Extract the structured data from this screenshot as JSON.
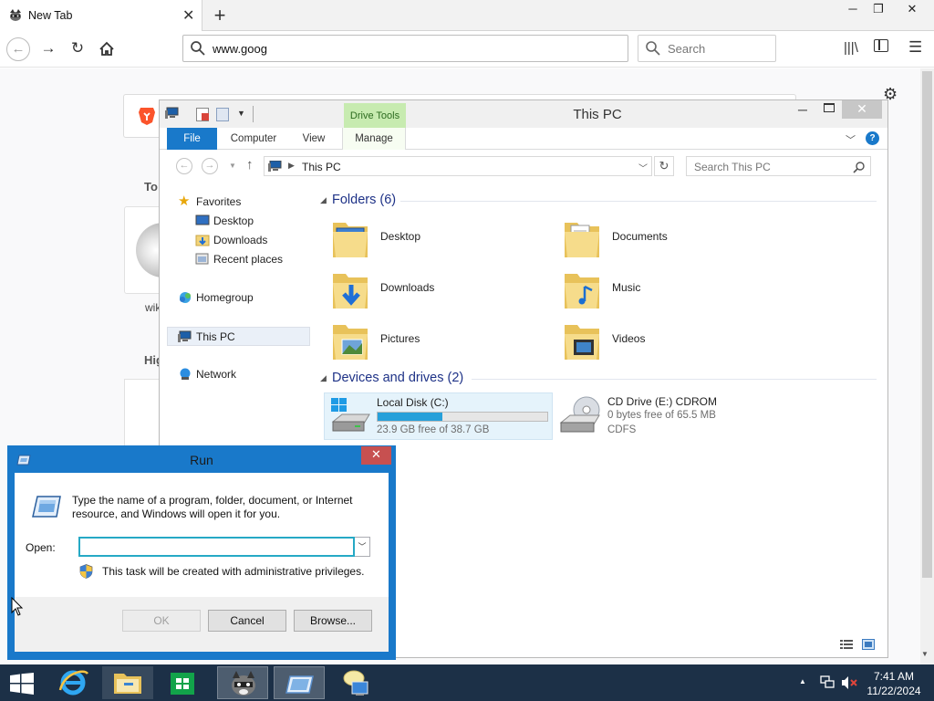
{
  "browser": {
    "tab_title": "New Tab",
    "tab_close": "✕",
    "new_tab": "+",
    "url_value": "www.goog",
    "search_placeholder": "Search",
    "win_min": "─",
    "win_max": "❐",
    "win_close": "✕"
  },
  "newtab_page": {
    "top_sites_heading": "To",
    "tile_label": "wik",
    "highlights_heading": "Hig"
  },
  "explorer": {
    "window_title": "This PC",
    "contextual_tab": "Drive Tools",
    "ribbon_tabs": [
      "File",
      "Computer",
      "View",
      "Manage"
    ],
    "address_path": "This PC",
    "search_placeholder": "Search This PC",
    "nav": {
      "favorites": "Favorites",
      "favorites_items": [
        "Desktop",
        "Downloads",
        "Recent places"
      ],
      "homegroup": "Homegroup",
      "this_pc": "This PC",
      "network": "Network"
    },
    "folders_header": "Folders (6)",
    "folders": [
      "Desktop",
      "Documents",
      "Downloads",
      "Music",
      "Pictures",
      "Videos"
    ],
    "devices_header": "Devices and drives (2)",
    "drives": [
      {
        "name": "Local Disk (C:)",
        "free_text": "23.9 GB free of 38.7 GB",
        "used_fraction": 0.38
      },
      {
        "name": "CD Drive (E:) CDROM",
        "free_text": "0 bytes free of 65.5 MB",
        "filesystem": "CDFS"
      }
    ]
  },
  "run_dialog": {
    "title": "Run",
    "description": "Type the name of a program, folder, document, or Internet resource, and Windows will open it for you.",
    "open_label": "Open:",
    "open_value": "",
    "admin_note": "This task will be created with administrative privileges.",
    "ok_label": "OK",
    "cancel_label": "Cancel",
    "browse_label": "Browse...",
    "close": "✕"
  },
  "taskbar": {
    "time": "7:41 AM",
    "date": "11/22/2024"
  },
  "colors": {
    "accent": "#1979ca",
    "taskbar": "#1c3047",
    "drive_tools": "#c7ebb0",
    "progress": "#26a0da"
  },
  "icons": [
    "firefox-icon",
    "search-icon",
    "home-icon",
    "reload-icon",
    "library-icon",
    "sidebar-icon",
    "menu-icon",
    "gear-icon",
    "brave-icon",
    "wikipedia-icon",
    "this-pc-icon",
    "folder-icon",
    "drive-icon",
    "cdrom-icon",
    "run-icon",
    "shield-icon",
    "windows-logo-icon",
    "ie-icon",
    "store-icon",
    "network-icon",
    "volume-muted-icon"
  ]
}
